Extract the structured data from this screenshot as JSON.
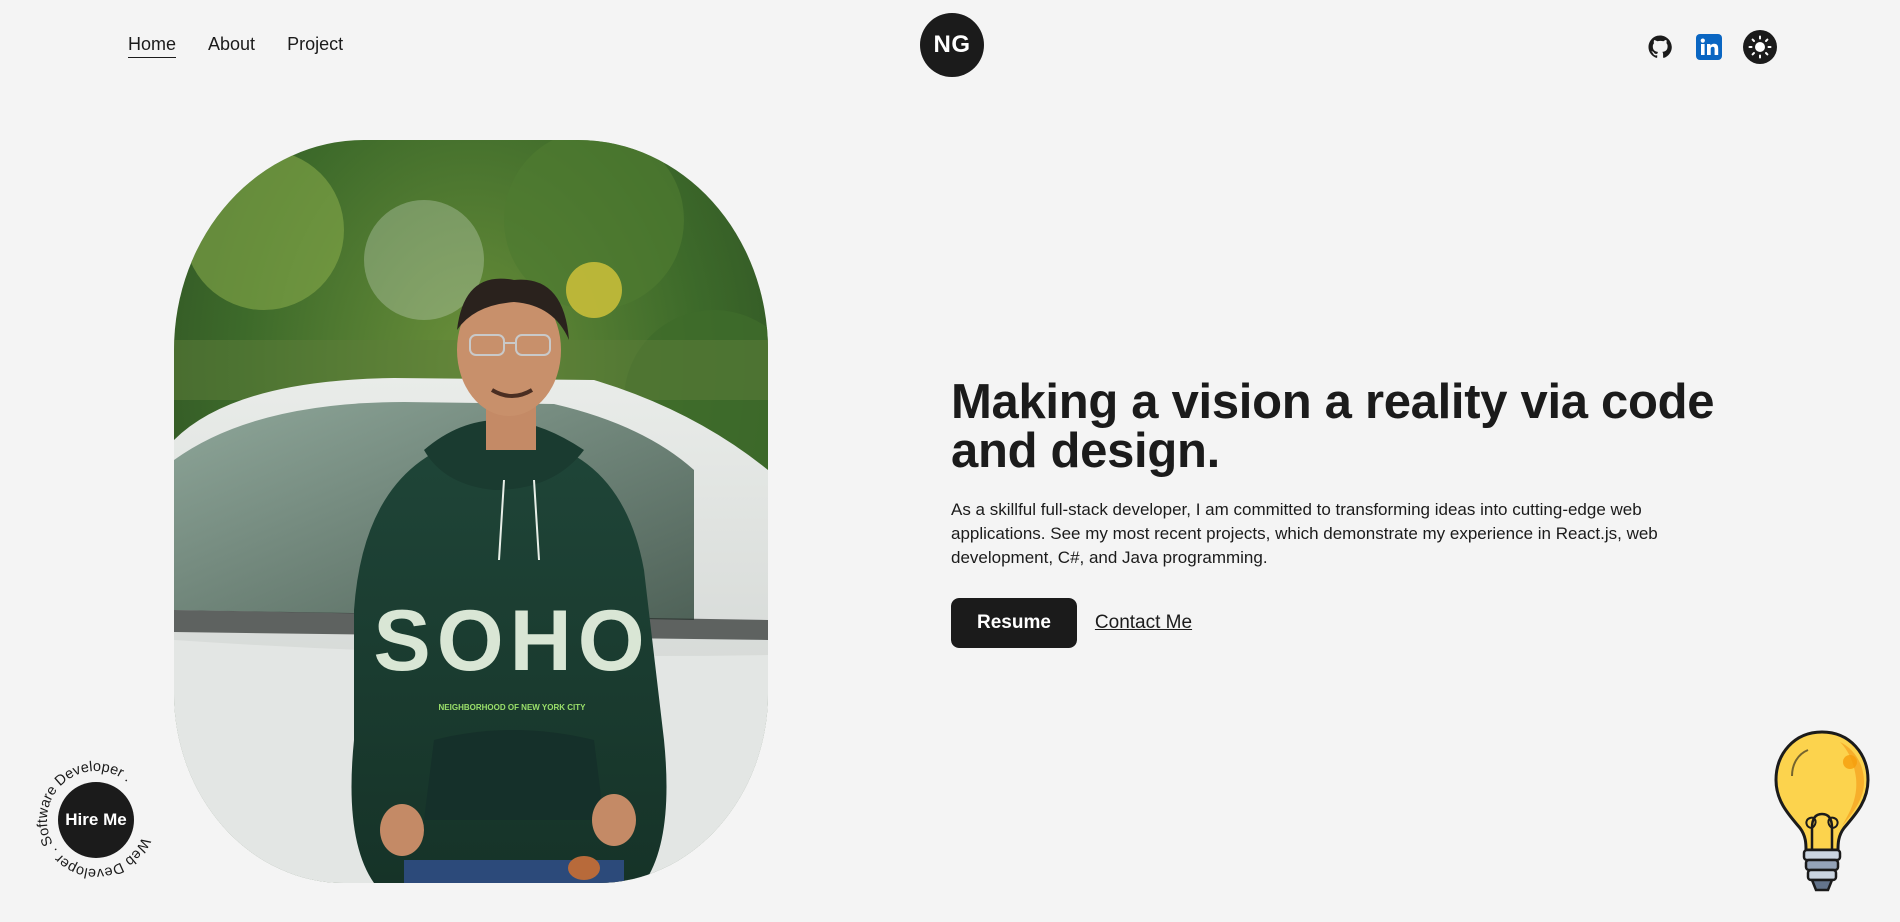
{
  "nav": {
    "links": [
      {
        "label": "Home",
        "active": true
      },
      {
        "label": "About",
        "active": false
      },
      {
        "label": "Project",
        "active": false
      }
    ],
    "logo": "NG",
    "socials": [
      {
        "icon": "github-icon"
      },
      {
        "icon": "linkedin-icon"
      },
      {
        "icon": "sun-icon"
      }
    ]
  },
  "hero": {
    "headline": "Making a vision a reality via code and design.",
    "description": "As a skillful full-stack developer, I am committed to transforming ideas into cutting-edge web applications. See my most recent projects, which demonstrate my experience in React.js, web development, C#, and Java programming.",
    "resume_label": "Resume",
    "contact_label": "Contact Me"
  },
  "photo": {
    "shirt_text": "SOHO",
    "shirt_subtext": "NEIGHBORHOOD OF NEW YORK CITY"
  },
  "hire": {
    "label": "Hire Me",
    "ring_text": "Web Developer . Software Developer ."
  },
  "colors": {
    "background": "#f4f4f4",
    "primary": "#1b1b1b",
    "linkedin": "#0a66c2",
    "bulb": "#fcd34d"
  }
}
